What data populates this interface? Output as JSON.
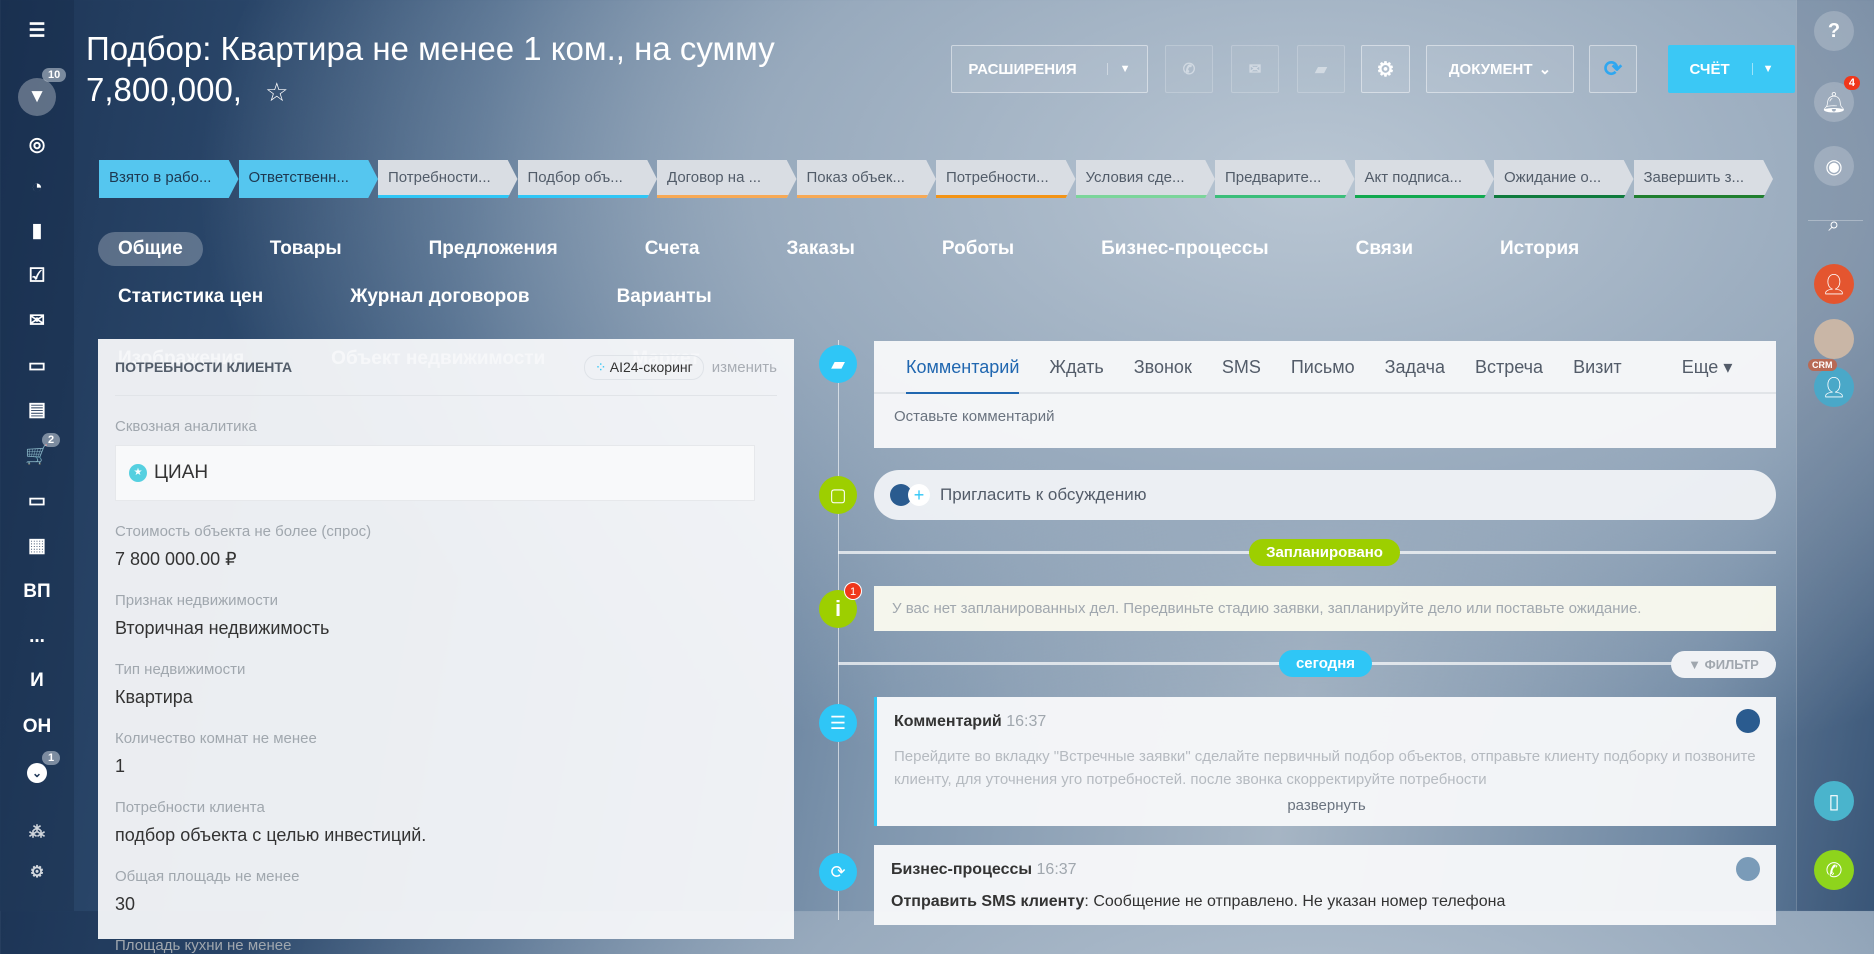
{
  "title": "Подбор: Квартира не менее 1 ком., на сумму 7,800,000,",
  "left_sidebar": {
    "filter_count": "10",
    "cart_count": "2",
    "chevron_count": "1",
    "text_items": [
      "ВП",
      "...",
      "И",
      "ОН"
    ]
  },
  "toolbar": {
    "extensions": "РАСШИРЕНИЯ",
    "document": "ДОКУМЕНТ",
    "invoice": "СЧЁТ"
  },
  "stages": [
    {
      "label": "Взято в рабо...",
      "color": "#55c6ef",
      "done": true
    },
    {
      "label": "Ответственн...",
      "color": "#55c6ef",
      "done": true
    },
    {
      "label": "Потребности...",
      "color": "#2fc6f6",
      "done": false
    },
    {
      "label": "Подбор объ...",
      "color": "#2fc6f6",
      "done": false
    },
    {
      "label": "Договор на ...",
      "color": "#f7a955",
      "done": false
    },
    {
      "label": "Показ объек...",
      "color": "#f7a955",
      "done": false
    },
    {
      "label": "Потребности...",
      "color": "#f39416",
      "done": false
    },
    {
      "label": "Условия сде...",
      "color": "#7bd59a",
      "done": false
    },
    {
      "label": "Предварите...",
      "color": "#3bbe7a",
      "done": false
    },
    {
      "label": "Акт подписа...",
      "color": "#11a94f",
      "done": false
    },
    {
      "label": "Ожидание о...",
      "color": "#0f7b3d",
      "done": false
    },
    {
      "label": "Завершить з...",
      "color": "#207f2f",
      "done": false
    }
  ],
  "tabs": [
    "Общие",
    "Товары",
    "Предложения",
    "Счета",
    "Заказы",
    "Роботы",
    "Бизнес-процессы",
    "Связи",
    "История",
    "Статистика цен",
    "Журнал договоров",
    "Варианты",
    "Изображения",
    "Объект недвижимости",
    "Маркет"
  ],
  "panel": {
    "title": "ПОТРЕБНОСТИ КЛИЕНТА",
    "ai_badge": "AI24-скоринг",
    "edit": "изменить",
    "analytics_label": "Сквозная аналитика",
    "analytics_value": "ЦИАН",
    "fields": [
      {
        "label": "Стоимость объекта не более (спрос)",
        "value": "7 800 000.00 ₽"
      },
      {
        "label": "Признак недвижимости",
        "value": "Вторичная недвижимость"
      },
      {
        "label": "Тип недвижимости",
        "value": "Квартира"
      },
      {
        "label": "Количество комнат не менее",
        "value": "1"
      },
      {
        "label": "Потребности клиента",
        "value": "подбор объекта с целью инвестиций."
      },
      {
        "label": "Общая площадь не менее",
        "value": "30"
      },
      {
        "label": "Площадь кухни не менее",
        "value": ""
      }
    ]
  },
  "editor": {
    "tabs": [
      "Комментарий",
      "Ждать",
      "Звонок",
      "SMS",
      "Письмо",
      "Задача",
      "Встреча",
      "Визит"
    ],
    "more": "Еще",
    "placeholder": "Оставьте комментарий"
  },
  "invite": "Пригласить к обсуждению",
  "planned_label": "Запланировано",
  "info": {
    "count": "1",
    "text": "У вас нет запланированных дел. Передвиньте стадию заявки, запланируйте дело или поставьте ожидание."
  },
  "today_label": "сегодня",
  "filter_label": "ФИЛЬТР",
  "comment": {
    "title": "Комментарий",
    "time": "16:37",
    "text": "Перейдите во вкладку \"Встречные заявки\" сделайте первичный подбор объектов, отправьте клиенту подборку и позвоните клиенту, для уточнения уго потребностей. после звонка скорректируйте потребности",
    "expand": "развернуть"
  },
  "bp": {
    "title": "Бизнес-процессы",
    "time": "16:37",
    "action": "Отправить SMS клиенту",
    "text": ": Сообщение не отправлено. Не указан номер телефона"
  },
  "right_sidebar": {
    "notifications": "4",
    "crm_badge": "CRM"
  }
}
